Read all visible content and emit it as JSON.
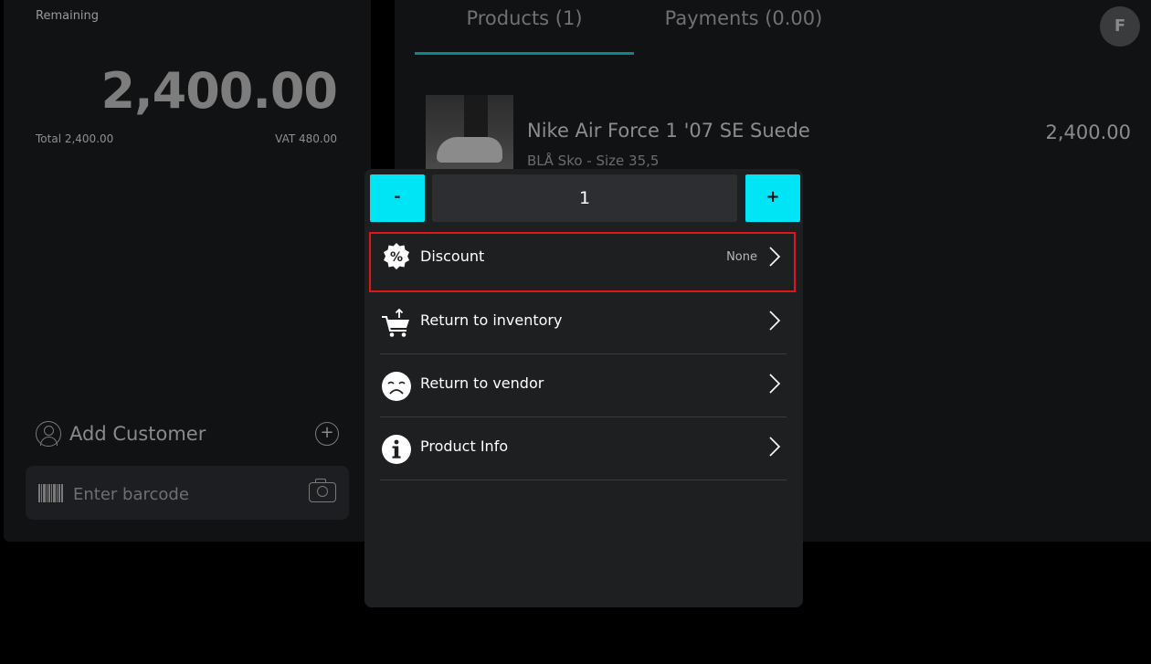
{
  "summary": {
    "remaining_label": "Remaining",
    "remaining_amount": "2,400.00",
    "total_label": "Total 2,400.00",
    "vat_label": "VAT 480.00"
  },
  "customer": {
    "add_customer_label": "Add Customer"
  },
  "barcode": {
    "placeholder": "Enter barcode"
  },
  "tabs": [
    {
      "label": "Products (1)",
      "active": true
    },
    {
      "label": "Payments (0.00)",
      "active": false
    }
  ],
  "avatar": {
    "initial": "F"
  },
  "product": {
    "name": "Nike Air Force 1 '07 SE Suede",
    "variant": "BLÅ Sko - Size 35,5",
    "price": "2,400.00"
  },
  "popover": {
    "quantity": {
      "minus_label": "-",
      "value": "1",
      "plus_label": "+"
    },
    "menu": [
      {
        "label": "Discount",
        "value": "None",
        "icon": "percent-badge-icon"
      },
      {
        "label": "Return to inventory",
        "value": "",
        "icon": "cart-return-icon"
      },
      {
        "label": "Return to vendor",
        "value": "",
        "icon": "sad-face-icon"
      },
      {
        "label": "Product Info",
        "value": "",
        "icon": "info-icon"
      }
    ]
  },
  "colors": {
    "accent_cyan": "#00e5f5",
    "tab_underline": "#10838d",
    "highlight_red": "#e0161b",
    "panel_bg": "#111214",
    "popover_bg": "#1e1f21"
  }
}
